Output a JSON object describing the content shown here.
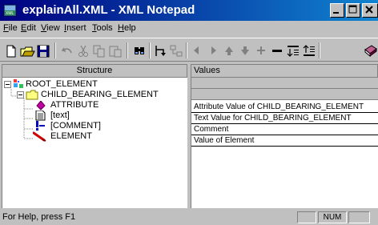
{
  "window": {
    "title": "explainAll.XML - XML Notepad",
    "buttons": [
      "minimize",
      "maximize",
      "close"
    ]
  },
  "menu": {
    "items": [
      {
        "label": "File",
        "access_key": "F"
      },
      {
        "label": "Edit",
        "access_key": "E"
      },
      {
        "label": "View",
        "access_key": "V"
      },
      {
        "label": "Insert",
        "access_key": "I"
      },
      {
        "label": "Tools",
        "access_key": "T"
      },
      {
        "label": "Help",
        "access_key": "H"
      }
    ]
  },
  "toolbar": {
    "buttons": [
      {
        "name": "new-icon",
        "enabled": true
      },
      {
        "name": "open-icon",
        "enabled": true
      },
      {
        "name": "save-icon",
        "enabled": true
      },
      {
        "name": "undo-icon",
        "enabled": false
      },
      {
        "name": "cut-icon",
        "enabled": false
      },
      {
        "name": "copy-icon",
        "enabled": false
      },
      {
        "name": "paste-icon",
        "enabled": false
      },
      {
        "name": "find-icon",
        "enabled": true
      },
      {
        "name": "insert-node-icon",
        "enabled": true
      },
      {
        "name": "insert-child-icon",
        "enabled": false
      },
      {
        "name": "move-left-icon",
        "enabled": false
      },
      {
        "name": "move-right-icon",
        "enabled": false
      },
      {
        "name": "move-up-icon",
        "enabled": false
      },
      {
        "name": "move-down-icon",
        "enabled": false
      },
      {
        "name": "expand-icon",
        "enabled": false
      },
      {
        "name": "collapse-icon",
        "enabled": true
      },
      {
        "name": "expand-all-icon",
        "enabled": true
      },
      {
        "name": "collapse-all-icon",
        "enabled": true
      },
      {
        "name": "help-book-icon",
        "enabled": true
      }
    ]
  },
  "structure": {
    "header": "Structure",
    "nodes": [
      {
        "label": "ROOT_ELEMENT",
        "icon": "root-element-icon",
        "depth": 0,
        "expander": "minus"
      },
      {
        "label": "CHILD_BEARING_ELEMENT",
        "icon": "folder-icon",
        "depth": 1,
        "expander": "minus"
      },
      {
        "label": "ATTRIBUTE",
        "icon": "attribute-diamond-icon",
        "depth": 2,
        "expander": "none"
      },
      {
        "label": "[text]",
        "icon": "text-page-icon",
        "depth": 2,
        "expander": "none"
      },
      {
        "label": "[COMMENT]",
        "icon": "comment-icon",
        "depth": 2,
        "expander": "none"
      },
      {
        "label": "ELEMENT",
        "icon": "element-leaf-icon",
        "depth": 2,
        "expander": "none"
      }
    ]
  },
  "values": {
    "header": "Values",
    "rows": [
      {
        "text": "",
        "style": "gray"
      },
      {
        "text": "",
        "style": "gray"
      },
      {
        "text": "Attribute Value of CHILD_BEARING_ELEMENT",
        "style": "white"
      },
      {
        "text": "Text Value for CHILD_BEARING_ELEMENT",
        "style": "white"
      },
      {
        "text": "Comment",
        "style": "white"
      },
      {
        "text": "Value of Element",
        "style": "white"
      }
    ]
  },
  "status": {
    "message": "For Help, press F1",
    "indicators": [
      "",
      "NUM",
      ""
    ]
  }
}
